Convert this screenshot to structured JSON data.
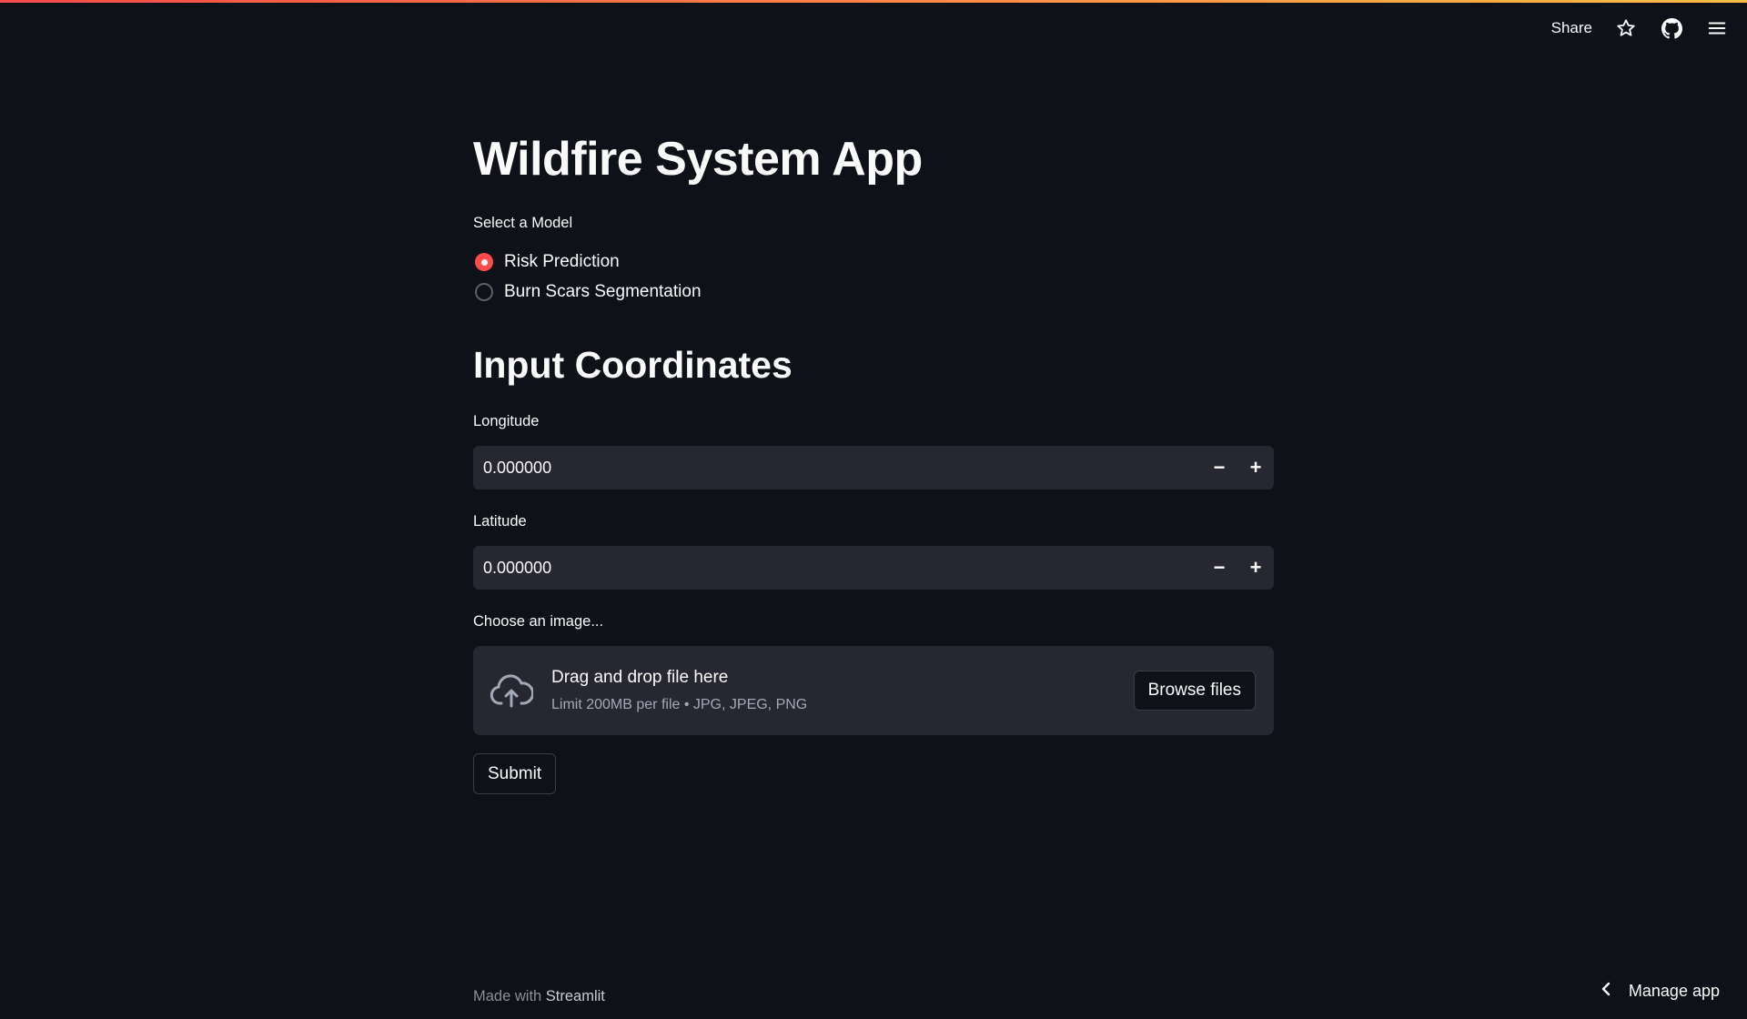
{
  "toolbar": {
    "share_label": "Share",
    "icons": [
      "star-icon",
      "github-icon",
      "hamburger-menu-icon"
    ]
  },
  "page": {
    "title": "Wildfire System App"
  },
  "model_select": {
    "label": "Select a Model",
    "options": [
      {
        "label": "Risk Prediction",
        "selected": true
      },
      {
        "label": "Burn Scars Segmentation",
        "selected": false
      }
    ]
  },
  "coordinates": {
    "heading": "Input Coordinates",
    "longitude": {
      "label": "Longitude",
      "value": "0.000000"
    },
    "latitude": {
      "label": "Latitude",
      "value": "0.000000"
    },
    "decrement_symbol": "−",
    "increment_symbol": "+"
  },
  "uploader": {
    "label": "Choose an image...",
    "drag_text": "Drag and drop file here",
    "limit_text": "Limit 200MB per file • JPG, JPEG, PNG",
    "browse_label": "Browse files",
    "icon": "cloud-upload-icon"
  },
  "submit_label": "Submit",
  "footer": {
    "prefix": "Made with ",
    "brand": "Streamlit"
  },
  "manage_app": {
    "label": "Manage app",
    "icon": "chevron-left-icon"
  },
  "colors": {
    "background": "#0e1117",
    "accent": "#ff4b4b",
    "input_bg": "#262730"
  }
}
